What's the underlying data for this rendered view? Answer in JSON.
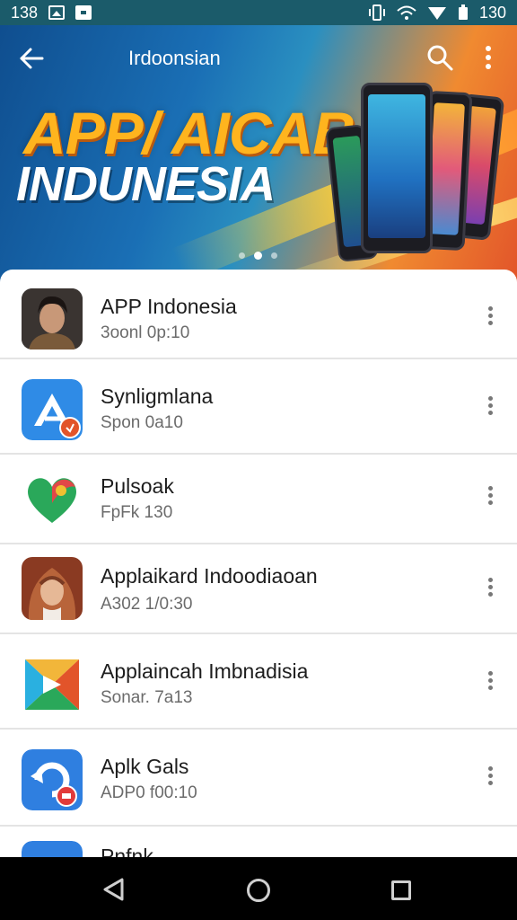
{
  "status_bar": {
    "time": "138",
    "battery": "130",
    "icons": [
      "image-icon",
      "download-icon",
      "vibrate-icon",
      "wifi-icon",
      "signal-icon",
      "battery-icon"
    ]
  },
  "toolbar": {
    "title": "Irdoonsian",
    "back_icon": "arrow-left-icon",
    "search_icon": "search-icon",
    "more_icon": "more-vert-icon"
  },
  "banner": {
    "line1": "APP/ AICAB",
    "line2": "INDUNESIA",
    "pages": 3,
    "active_page": 2
  },
  "apps": [
    {
      "name": "APP Indonesia",
      "subtitle": "3oonl 0p:10",
      "icon": "portrait-man-icon"
    },
    {
      "name": "Synligmlana",
      "subtitle": "Spon 0a10",
      "icon": "blue-a-app-icon"
    },
    {
      "name": "Pulsoak",
      "subtitle": "FpFk 130",
      "icon": "green-heart-pin-icon"
    },
    {
      "name": "Applaikard Indoodiaoan",
      "subtitle": "A302 1/0:30",
      "icon": "portrait-woman-hijab-icon"
    },
    {
      "name": "Applaincah Imbnadisia",
      "subtitle": "Sonar. 7a13",
      "icon": "multicolor-play-icon"
    },
    {
      "name": "Aplk Gals",
      "subtitle": "ADP0 f00:10",
      "icon": "blue-sync-app-icon"
    },
    {
      "name": "Pnfnk",
      "subtitle": "",
      "icon": "blue-partial-app-icon"
    }
  ],
  "nav_bar": {
    "back": "nav-back-icon",
    "home": "nav-home-icon",
    "recents": "nav-recents-icon"
  },
  "colors": {
    "status_bar": "#1b5b6a",
    "banner_blue": "#1a6fb5",
    "banner_orange": "#f08a30",
    "headline_gold": "#ffb41e"
  }
}
